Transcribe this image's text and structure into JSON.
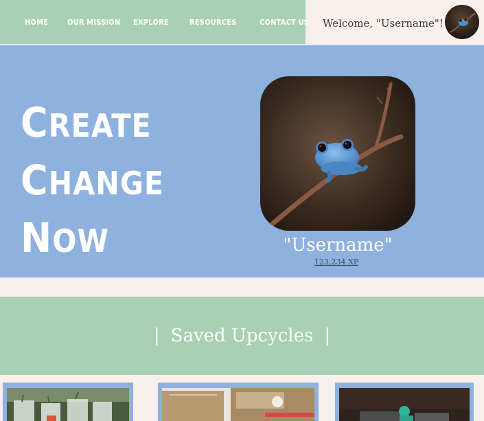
{
  "nav": {
    "items": [
      {
        "label": "HOME"
      },
      {
        "label": "OUR MISSION"
      },
      {
        "label": "EXPLORE"
      },
      {
        "label": "RESOURCES"
      },
      {
        "label": "CONTACT US"
      }
    ],
    "welcome": "Welcome, \"Username\"!"
  },
  "hero": {
    "lines": [
      "Create",
      "Change",
      "Now"
    ],
    "username": "\"Username\"",
    "xp": "123,234 XP"
  },
  "saved": {
    "title": "Saved Upcycles",
    "divider": "|"
  },
  "colors": {
    "nav_green": "#a9d0b5",
    "hero_blue": "#8eb1de",
    "cream": "#f8f0ec",
    "text_dark": "#3b3b3b"
  }
}
